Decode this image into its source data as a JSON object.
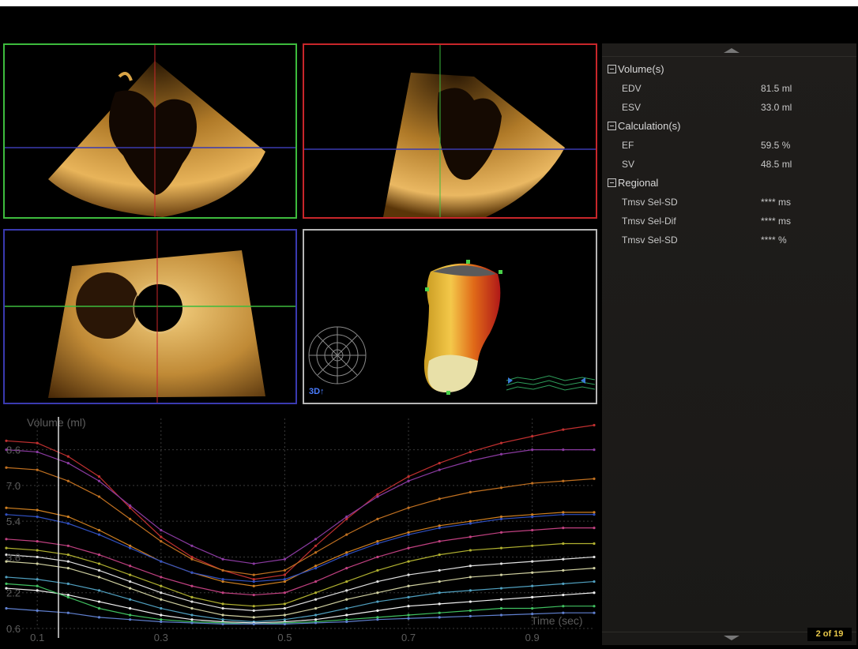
{
  "colors": {
    "view1_border": "#3dbb3d",
    "view2_border": "#c8262a",
    "view3_border": "#3a3ab0",
    "view4_border": "#b5b5b5",
    "pager_text": "#e8c84a"
  },
  "views": {
    "view_3d_label": "3D↑"
  },
  "results": {
    "sections": [
      {
        "title": "Volume(s)",
        "rows": [
          {
            "label": "EDV",
            "value": "81.5 ml"
          },
          {
            "label": "ESV",
            "value": "33.0 ml"
          }
        ]
      },
      {
        "title": "Calculation(s)",
        "rows": [
          {
            "label": "EF",
            "value": "59.5 %"
          },
          {
            "label": "SV",
            "value": "48.5 ml"
          }
        ]
      },
      {
        "title": "Regional",
        "rows": [
          {
            "label": "Tmsv Sel-SD",
            "value": "**** ms"
          },
          {
            "label": "Tmsv Sel-Dif",
            "value": "**** ms"
          },
          {
            "label": "Tmsv Sel-SD",
            "value": "**** %"
          }
        ]
      }
    ],
    "scroll_up_icon": "scroll-up-arrow",
    "scroll_down_icon": "scroll-down-arrow"
  },
  "pager": "2 of 19",
  "chart_data": {
    "type": "line",
    "ylabel": "Volume (ml)",
    "xlabel": "Time (sec)",
    "y_ticks": [
      "8.6",
      "7.0",
      "5.4",
      "3.8",
      "2.2",
      "0.6"
    ],
    "x_ticks": [
      "0.1",
      "0.3",
      "0.5",
      "0.7",
      "0.9"
    ],
    "xlim": [
      0.05,
      1.0
    ],
    "ylim": [
      0.6,
      10.0
    ],
    "x": [
      0.05,
      0.1,
      0.15,
      0.2,
      0.25,
      0.3,
      0.35,
      0.4,
      0.45,
      0.5,
      0.55,
      0.6,
      0.65,
      0.7,
      0.75,
      0.8,
      0.85,
      0.9,
      0.95,
      1.0
    ],
    "series": [
      {
        "color": "#c03030",
        "values": [
          9.0,
          8.9,
          8.3,
          7.4,
          6.0,
          4.7,
          3.8,
          3.2,
          2.8,
          3.0,
          4.3,
          5.5,
          6.6,
          7.4,
          8.0,
          8.5,
          8.9,
          9.2,
          9.5,
          9.7
        ]
      },
      {
        "color": "#8a3aa0",
        "values": [
          8.6,
          8.5,
          8.0,
          7.2,
          6.1,
          5.0,
          4.3,
          3.7,
          3.5,
          3.7,
          4.6,
          5.6,
          6.5,
          7.2,
          7.7,
          8.1,
          8.4,
          8.6,
          8.6,
          8.6
        ]
      },
      {
        "color": "#c07020",
        "values": [
          7.8,
          7.7,
          7.2,
          6.5,
          5.5,
          4.5,
          3.7,
          3.2,
          3.0,
          3.2,
          4.0,
          4.8,
          5.5,
          6.0,
          6.4,
          6.7,
          6.9,
          7.1,
          7.2,
          7.3
        ]
      },
      {
        "color": "#d08020",
        "values": [
          6.0,
          5.9,
          5.6,
          5.0,
          4.3,
          3.6,
          3.1,
          2.7,
          2.5,
          2.7,
          3.4,
          4.0,
          4.5,
          4.9,
          5.2,
          5.4,
          5.6,
          5.7,
          5.8,
          5.8
        ]
      },
      {
        "color": "#3050c0",
        "values": [
          5.7,
          5.6,
          5.3,
          4.8,
          4.2,
          3.6,
          3.1,
          2.8,
          2.7,
          2.8,
          3.3,
          3.9,
          4.4,
          4.8,
          5.1,
          5.3,
          5.5,
          5.6,
          5.7,
          5.7
        ]
      },
      {
        "color": "#c04080",
        "values": [
          4.6,
          4.5,
          4.3,
          3.9,
          3.4,
          2.9,
          2.5,
          2.2,
          2.1,
          2.2,
          2.7,
          3.3,
          3.8,
          4.2,
          4.5,
          4.7,
          4.9,
          5.0,
          5.1,
          5.1
        ]
      },
      {
        "color": "#b0b030",
        "values": [
          4.2,
          4.1,
          3.9,
          3.5,
          3.0,
          2.5,
          2.0,
          1.7,
          1.6,
          1.7,
          2.2,
          2.7,
          3.2,
          3.6,
          3.9,
          4.1,
          4.2,
          4.3,
          4.4,
          4.4
        ]
      },
      {
        "color": "#e0e0e0",
        "values": [
          3.9,
          3.8,
          3.6,
          3.2,
          2.7,
          2.2,
          1.8,
          1.5,
          1.4,
          1.5,
          1.9,
          2.3,
          2.7,
          3.0,
          3.2,
          3.4,
          3.5,
          3.6,
          3.7,
          3.8
        ]
      },
      {
        "color": "#d0d0a0",
        "values": [
          3.6,
          3.5,
          3.3,
          2.9,
          2.4,
          1.9,
          1.5,
          1.2,
          1.1,
          1.2,
          1.5,
          1.9,
          2.2,
          2.5,
          2.7,
          2.9,
          3.0,
          3.1,
          3.2,
          3.3
        ]
      },
      {
        "color": "#50a0c0",
        "values": [
          2.9,
          2.8,
          2.6,
          2.3,
          1.9,
          1.5,
          1.2,
          1.0,
          0.9,
          1.0,
          1.2,
          1.5,
          1.8,
          2.0,
          2.2,
          2.3,
          2.4,
          2.5,
          2.6,
          2.7
        ]
      },
      {
        "color": "#f0f0f0",
        "values": [
          2.4,
          2.3,
          2.1,
          1.8,
          1.5,
          1.2,
          1.0,
          0.9,
          0.85,
          0.9,
          1.0,
          1.2,
          1.4,
          1.6,
          1.7,
          1.8,
          1.9,
          2.0,
          2.1,
          2.2
        ]
      },
      {
        "color": "#40c060",
        "values": [
          2.6,
          2.5,
          2.0,
          1.5,
          1.2,
          1.0,
          0.9,
          0.85,
          0.8,
          0.85,
          0.9,
          1.0,
          1.1,
          1.2,
          1.3,
          1.4,
          1.5,
          1.5,
          1.6,
          1.6
        ]
      },
      {
        "color": "#6080d0",
        "values": [
          1.5,
          1.4,
          1.3,
          1.1,
          1.0,
          0.9,
          0.85,
          0.8,
          0.8,
          0.8,
          0.85,
          0.9,
          1.0,
          1.05,
          1.1,
          1.15,
          1.2,
          1.25,
          1.3,
          1.3
        ]
      }
    ]
  }
}
